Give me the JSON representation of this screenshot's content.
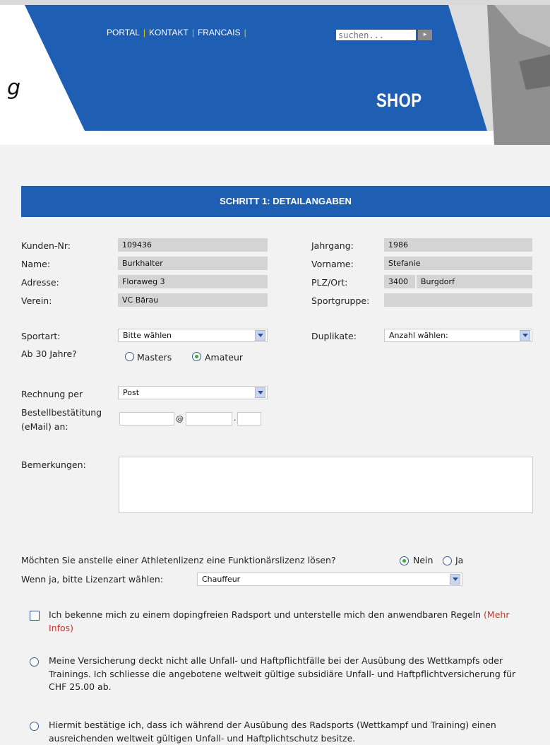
{
  "header": {
    "nav": [
      "PORTAL",
      "KONTAKT",
      "FRANCAIS"
    ],
    "search_placeholder": "suchen...",
    "search_button_glyph": "▸",
    "logo_fragment": "g",
    "section_title": "SHOP"
  },
  "step_title": "SCHRITT 1: DETAILANGABEN",
  "form": {
    "kunden_nr": {
      "label": "Kunden-Nr:",
      "value": "109436"
    },
    "name": {
      "label": "Name:",
      "value": "Burkhalter"
    },
    "adresse": {
      "label": "Adresse:",
      "value": "Floraweg 3"
    },
    "verein": {
      "label": "Verein:",
      "value": "VC Bärau"
    },
    "jahrgang": {
      "label": "Jahrgang:",
      "value": "1986"
    },
    "vorname": {
      "label": "Vorname:",
      "value": "Stefanie"
    },
    "plz_ort": {
      "label": "PLZ/Ort:",
      "plz": "3400",
      "ort": "Burgdorf"
    },
    "sportgruppe": {
      "label": "Sportgruppe:",
      "value": ""
    },
    "sportart": {
      "label": "Sportart:",
      "selected": "Bitte wählen"
    },
    "duplikate": {
      "label": "Duplikate:",
      "selected": "Anzahl wählen:"
    },
    "ab30": {
      "label": "Ab 30 Jahre?",
      "options": [
        "Masters",
        "Amateur"
      ],
      "selected": "Amateur"
    },
    "rechnung": {
      "label": "Rechnung per",
      "selected": "Post"
    },
    "bestellbestaetigung": {
      "label1": "Bestellbestätitung",
      "label2": "(eMail) an:",
      "at": "@",
      "dot": "."
    },
    "bemerkungen": {
      "label": "Bemerkungen:"
    },
    "funktionaer": {
      "question": "Möchten Sie anstelle einer Athletenlizenz eine Funktionärslizenz lösen?",
      "options": [
        "Nein",
        "Ja"
      ],
      "selected": "Nein"
    },
    "lizenzart": {
      "label": "Wenn ja, bitte Lizenzart wählen:",
      "selected": "Chauffeur"
    },
    "doping": {
      "text": "Ich bekenne mich zu einem dopingfreien Radsport und unterstelle mich den anwendbaren Regeln",
      "link": "(Mehr Infos)",
      "checked": false
    },
    "versicherung1": "Meine Versicherung deckt nicht alle Unfall- und Haftpflichtfälle bei der Ausübung des Wettkampfs oder Trainings. Ich schliesse die angebotene weltweit gültige subsidiäre Unfall- und Haftpflichtversicherung für CHF 25.00 ab.",
    "versicherung2": "Hiermit bestätige ich, dass ich während der Ausübung des Radsports (Wettkampf und Training) einen ausreichenden weltweit gültigen Unfall- und Haftplichtschutz besitze."
  },
  "colors": {
    "brand_blue": "#1e5fb4",
    "field_grey": "#d4d4d4",
    "radio_green": "#3dab3d",
    "link_red": "#c0392b"
  }
}
